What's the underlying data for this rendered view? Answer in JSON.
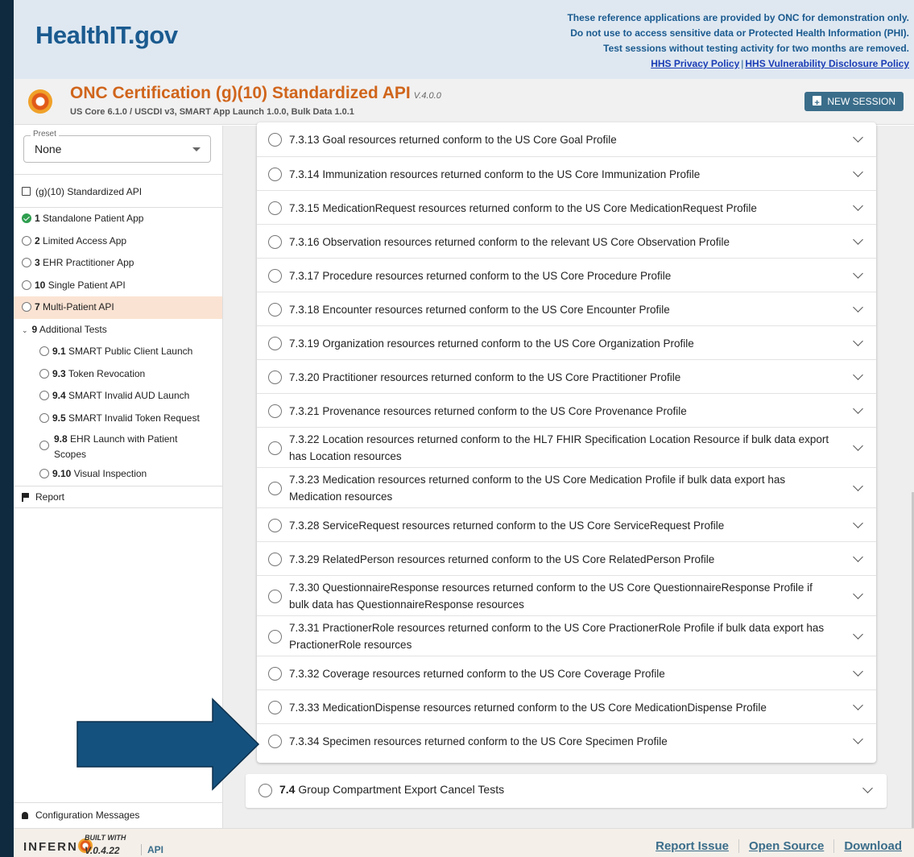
{
  "banner": {
    "logo": "HealthIT.gov",
    "notice_lines": [
      "These reference applications are provided by ONC for demonstration only.",
      "Do not use to access sensitive data or Protected Health Information (PHI).",
      "Test sessions without testing activity for two months are removed."
    ],
    "privacy_link": "HHS Privacy Policy",
    "separator": "|",
    "vuln_link": "HHS Vulnerability Disclosure Policy"
  },
  "app": {
    "title": "ONC Certification (g)(10) Standardized API",
    "version": "V.4.0.0",
    "subtitle": "US Core 6.1.0 / USCDI v3, SMART App Launch 1.0.0, Bulk Data 1.0.1",
    "new_session": "NEW SESSION"
  },
  "sidebar": {
    "preset_label": "Preset",
    "preset_value": "None",
    "suite": "(g)(10) Standardized API",
    "items": [
      {
        "num": "1",
        "label": "Standalone Patient App",
        "status": "pass"
      },
      {
        "num": "2",
        "label": "Limited Access App",
        "status": "none"
      },
      {
        "num": "3",
        "label": "EHR Practitioner App",
        "status": "none"
      },
      {
        "num": "10",
        "label": "Single Patient API",
        "status": "none"
      },
      {
        "num": "7",
        "label": "Multi-Patient API",
        "status": "none",
        "active": true
      },
      {
        "num": "9",
        "label": "Additional Tests",
        "status": "group"
      }
    ],
    "subitems": [
      {
        "num": "9.1",
        "label": "SMART Public Client Launch"
      },
      {
        "num": "9.3",
        "label": "Token Revocation"
      },
      {
        "num": "9.4",
        "label": "SMART Invalid AUD Launch"
      },
      {
        "num": "9.5",
        "label": "SMART Invalid Token Request"
      },
      {
        "num": "9.8",
        "label": "EHR Launch with Patient Scopes"
      },
      {
        "num": "9.10",
        "label": "Visual Inspection"
      }
    ],
    "report": "Report",
    "config": "Configuration Messages"
  },
  "tests": [
    {
      "id": "7.3.13",
      "text": "Goal resources returned conform to the US Core Goal Profile"
    },
    {
      "id": "7.3.14",
      "text": "Immunization resources returned conform to the US Core Immunization Profile"
    },
    {
      "id": "7.3.15",
      "text": "MedicationRequest resources returned conform to the US Core MedicationRequest Profile"
    },
    {
      "id": "7.3.16",
      "text": "Observation resources returned conform to the relevant US Core Observation Profile"
    },
    {
      "id": "7.3.17",
      "text": "Procedure resources returned conform to the US Core Procedure Profile"
    },
    {
      "id": "7.3.18",
      "text": "Encounter resources returned conform to the US Core Encounter Profile"
    },
    {
      "id": "7.3.19",
      "text": "Organization resources returned conform to the US Core Organization Profile"
    },
    {
      "id": "7.3.20",
      "text": "Practitioner resources returned conform to the US Core Practitioner Profile"
    },
    {
      "id": "7.3.21",
      "text": "Provenance resources returned conform to the US Core Provenance Profile"
    },
    {
      "id": "7.3.22",
      "text": "Location resources returned conform to the HL7 FHIR Specification Location Resource if bulk data export has Location resources"
    },
    {
      "id": "7.3.23",
      "text": "Medication resources returned conform to the US Core Medication Profile if bulk data export has Medication resources"
    },
    {
      "id": "7.3.28",
      "text": "ServiceRequest resources returned conform to the US Core ServiceRequest Profile"
    },
    {
      "id": "7.3.29",
      "text": "RelatedPerson resources returned conform to the US Core RelatedPerson Profile"
    },
    {
      "id": "7.3.30",
      "text": "QuestionnaireResponse resources returned conform to the US Core QuestionnaireResponse Profile if bulk data has QuestionnaireResponse resources"
    },
    {
      "id": "7.3.31",
      "text": "PractionerRole resources returned conform to the US Core PractionerRole Profile if bulk data export has PractionerRole resources"
    },
    {
      "id": "7.3.32",
      "text": "Coverage resources returned conform to the US Core Coverage Profile"
    },
    {
      "id": "7.3.33",
      "text": "MedicationDispense resources returned conform to the US Core MedicationDispense Profile"
    },
    {
      "id": "7.3.34",
      "text": "Specimen resources returned conform to the US Core Specimen Profile"
    }
  ],
  "group74": {
    "id": "7.4",
    "text": "Group Compartment Export Cancel Tests"
  },
  "footer": {
    "brand_pre": "INFERN",
    "built_with": "BUILT WITH",
    "version": "V.0.4.22",
    "api": "API",
    "links": [
      "Report Issue",
      "Open Source",
      "Download"
    ]
  },
  "colors": {
    "accent": "#d0651b",
    "button": "#3a6d8a",
    "arrow": "#15517e",
    "active_nav": "#fbe3d3"
  }
}
